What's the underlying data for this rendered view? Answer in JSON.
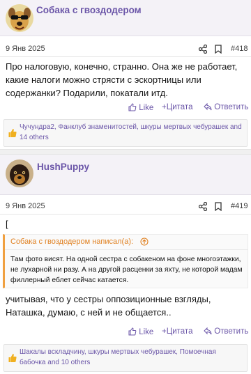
{
  "posts": [
    {
      "username": "Собака с гвоздодером",
      "date": "9 Янв 2025",
      "post_number": "#418",
      "body": "Про налоговую, конечно, странно. Она же не работает, какие налоги можно стрясти с эскортницы или содержанки? Подарили, покатали итд.",
      "actions": {
        "like": "Like",
        "quote": "Цитата",
        "reply": "Ответить"
      },
      "reactions": "Чучундра2, Фанклуб знаменитостей, шкуры мертвых чебурашек and 14 others"
    },
    {
      "username": "HushPuppy",
      "date": "9 Янв 2025",
      "post_number": "#419",
      "bracket": "[",
      "quote": {
        "author": "Собака с гвоздодером написал(а):",
        "text": "Там фото висят. На одной сестра с собакеном на фоне многоэтажки, не лухарной ни разу. А на другой расценки за яхту, не которой мадам филлерный еблет сейчас катается."
      },
      "body": "учитывая, что у сестры оппозиционные взгляды, Наташка, думаю, с ней и не общается..",
      "actions": {
        "like": "Like",
        "quote": "Цитата",
        "reply": "Ответить"
      },
      "reactions": "Шакалы вскладчину, шкуры мертвых чебурашек, Помоечная бабочка and 10 others"
    }
  ],
  "colors": {
    "accent": "#6b56a8",
    "quote_accent": "#f0a040",
    "reaction_icon": "#f0b020"
  }
}
